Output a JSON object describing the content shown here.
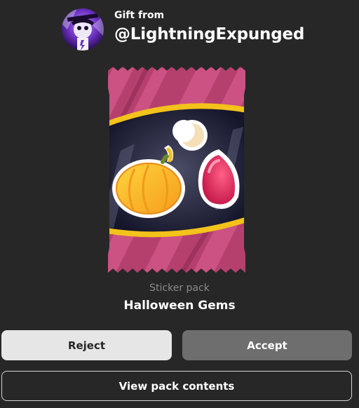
{
  "gift": {
    "from_label": "Gift from",
    "username": "@LightningExpunged"
  },
  "pack": {
    "type_label": "Sticker pack",
    "name": "Halloween Gems",
    "icons": [
      "pumpkin-sticker",
      "moon-sticker",
      "red-gem-sticker"
    ]
  },
  "actions": {
    "reject_label": "Reject",
    "accept_label": "Accept",
    "view_label": "View pack contents"
  },
  "colors": {
    "background": "#272727",
    "reject_bg": "#e6e6e6",
    "accept_bg": "#6e6e6e",
    "pack_wrapper": "#b5406e",
    "pack_band": "#f3c21b"
  }
}
